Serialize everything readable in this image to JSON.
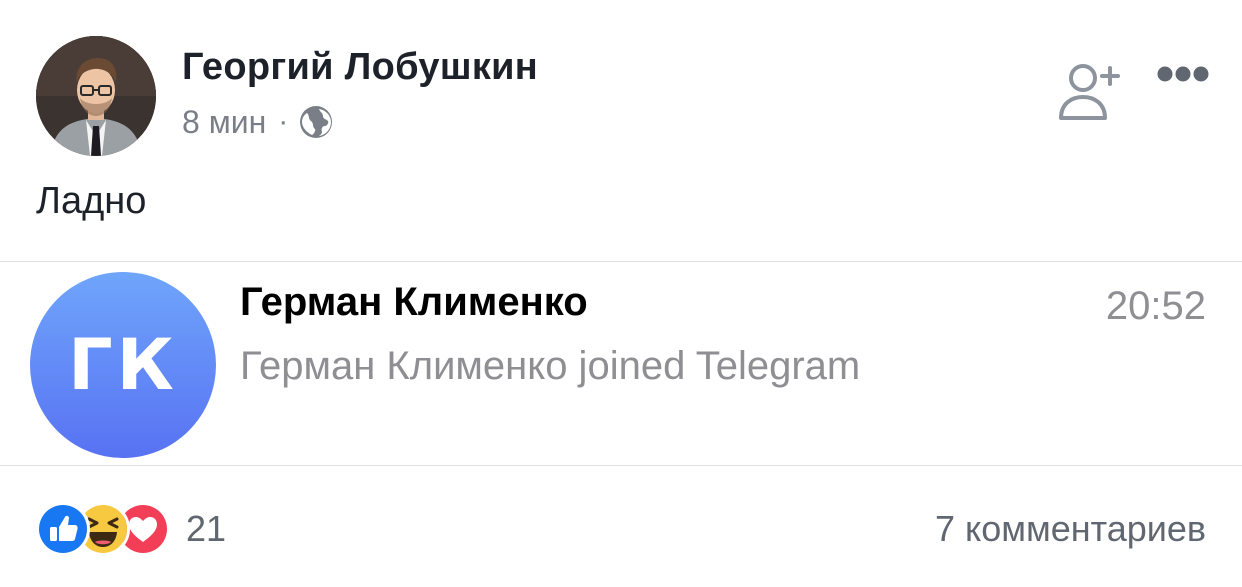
{
  "post": {
    "author_name": "Георгий Лобушкин",
    "time": "8 мин",
    "separator": "·",
    "privacy_icon": "globe-icon",
    "text": "Ладно",
    "header_actions": [
      "add-friend-icon",
      "more-icon"
    ]
  },
  "telegram_row": {
    "avatar_initials": "ГК",
    "avatar_color_top": "#6fa5fb",
    "avatar_color_bottom": "#5872f3",
    "name": "Герман Клименко",
    "message": "Герман Клименко joined Telegram",
    "time": "20:52"
  },
  "footer": {
    "reactions": [
      "like-icon",
      "haha-icon",
      "love-icon"
    ],
    "reaction_count": "21",
    "comments": "7 комментариев"
  },
  "colors": {
    "facebook_blue": "#1877f2",
    "love_red": "#f33e58",
    "haha_yellow": "#f7c940",
    "meta_gray": "#7a7f87"
  }
}
